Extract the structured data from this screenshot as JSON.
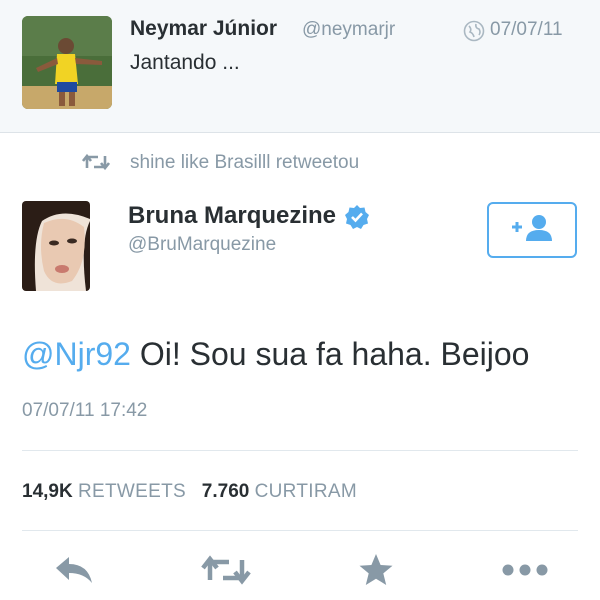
{
  "top_tweet": {
    "name": "Neymar Júnior",
    "handle": "@neymarjr",
    "date": "07/07/11",
    "text": "Jantando ..."
  },
  "retweet_context": "shine like Brasilll retweetou",
  "main_tweet": {
    "name": "Bruna Marquezine",
    "handle": "@BruMarquezine",
    "mention": "@Njr92",
    "text": " Oi! Sou sua fa haha. Beijoo",
    "timestamp": "07/07/11 17:42",
    "retweets_count": "14,9K",
    "retweets_label": "RETWEETS",
    "likes_count": "7.760",
    "likes_label": "CURTIRAM"
  },
  "icons": {
    "globe": "globe-icon",
    "retweet": "retweet-icon",
    "verified": "verified-badge-icon",
    "follow": "add-user-icon",
    "reply": "reply-icon",
    "favorite": "star-icon",
    "more": "more-dots-icon"
  },
  "colors": {
    "accent": "#55acee",
    "muted": "#8899a6",
    "text": "#292f33",
    "top_background": "#f5f8fa"
  }
}
